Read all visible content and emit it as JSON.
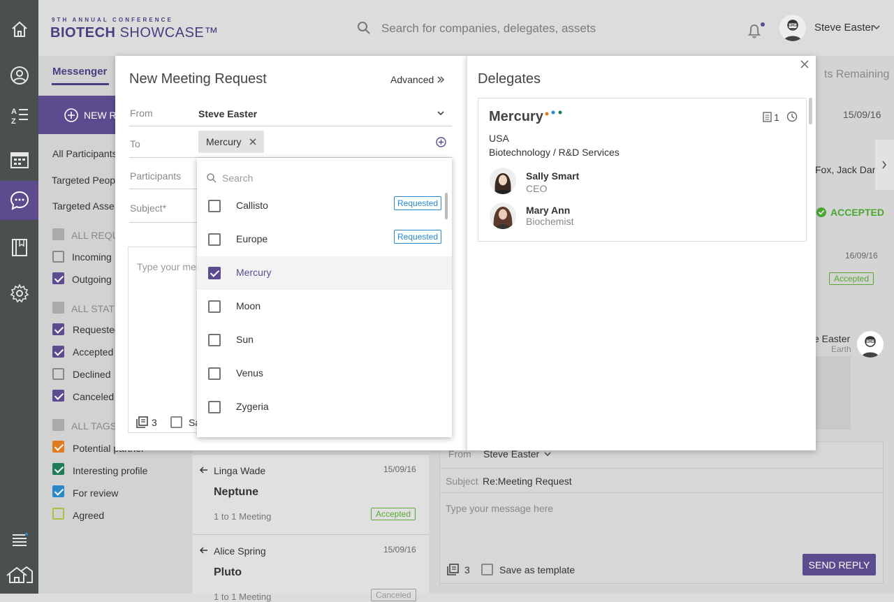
{
  "header": {
    "logo_small": "9TH ANNUAL CONFERENCE",
    "logo_big_bold": "BIOTECH",
    "logo_big_thin": "SHOWCASE™",
    "search_placeholder": "Search for companies, delegates, assets",
    "user_name": "Steve Easter"
  },
  "sidebar": {
    "icons": [
      "home-icon",
      "profile-icon",
      "az-list-icon",
      "calendar-icon",
      "messenger-icon",
      "book-icon",
      "settings-icon",
      "list-icon",
      "house-icon"
    ]
  },
  "messenger": {
    "tab_label": "Messenger",
    "new_request_label": "NEW RE",
    "filters": [
      {
        "label": "All Participants",
        "kind": "link"
      },
      {
        "label": "Targeted Peop",
        "kind": "link"
      },
      {
        "label": "Targeted Asse",
        "kind": "link"
      }
    ],
    "groups": [
      {
        "header": "ALL REQU",
        "items": [
          {
            "label": "Incoming",
            "checked": false
          },
          {
            "label": "Outgoing",
            "checked": true
          }
        ]
      },
      {
        "header": "ALL STAT",
        "items": [
          {
            "label": "Requested",
            "checked": true
          },
          {
            "label": "Accepted",
            "checked": true
          },
          {
            "label": "Declined",
            "checked": false
          },
          {
            "label": "Canceled",
            "checked": true
          }
        ]
      },
      {
        "header": "ALL TAGS",
        "items": [
          {
            "label": "Potential partner",
            "color": "#e07b20"
          },
          {
            "label": "Interesting profile",
            "color": "#1e7d57"
          },
          {
            "label": "For review",
            "color": "#2d88c8"
          },
          {
            "label": "Agreed",
            "color": "#a5c23e"
          }
        ]
      }
    ]
  },
  "background_right": {
    "remaining": "ts Remaining",
    "date1": "15/09/16",
    "names": "Fox, Jack Dan",
    "accepted": "ACCEPTED",
    "date2": "16/09/16",
    "accepted_badge": "Accepted",
    "sender_name": "e Easter",
    "sender_sub": "Earth"
  },
  "cards": [
    {
      "from": "Linga Wade",
      "date": "15/09/16",
      "title": "Neptune",
      "type": "1 to 1 Meeting",
      "status": "Accepted"
    },
    {
      "from": "Alice Spring",
      "date": "15/09/16",
      "title": "Pluto",
      "type": "1 to 1 Meeting",
      "status": "Canceled"
    }
  ],
  "reply": {
    "from_label": "From",
    "from_value": "Steve Easter",
    "subject_label": "Subject",
    "subject_value": "Re:Meeting Request",
    "message_placeholder": "Type your message here",
    "attachments": "3",
    "save_template": "Save as template",
    "send_label": "SEND REPLY"
  },
  "modal": {
    "title": "New Meeting Request",
    "advanced": "Advanced",
    "from_label": "From",
    "from_value": "Steve Easter",
    "to_label": "To",
    "to_chip": "Mercury",
    "participants_label": "Participants",
    "subject_label": "Subject*",
    "message_placeholder": "Type your mes",
    "attachments": "3",
    "save_partial": "Sa",
    "dropdown": {
      "search_placeholder": "Search",
      "items": [
        {
          "name": "Callisto",
          "checked": false,
          "badge": "Requested"
        },
        {
          "name": "Europe",
          "checked": false,
          "badge": "Requested"
        },
        {
          "name": "Mercury",
          "checked": true,
          "badge": ""
        },
        {
          "name": "Moon",
          "checked": false,
          "badge": ""
        },
        {
          "name": "Sun",
          "checked": false,
          "badge": ""
        },
        {
          "name": "Venus",
          "checked": false,
          "badge": ""
        },
        {
          "name": "Zygeria",
          "checked": false,
          "badge": ""
        }
      ]
    }
  },
  "delegates": {
    "title": "Delegates",
    "company": "Mercury",
    "country": "USA",
    "industry": "Biotechnology / R&D Services",
    "doc_count": "1",
    "people": [
      {
        "name": "Sally Smart",
        "role": "CEO"
      },
      {
        "name": "Mary Ann",
        "role": "Biochemist"
      }
    ]
  }
}
